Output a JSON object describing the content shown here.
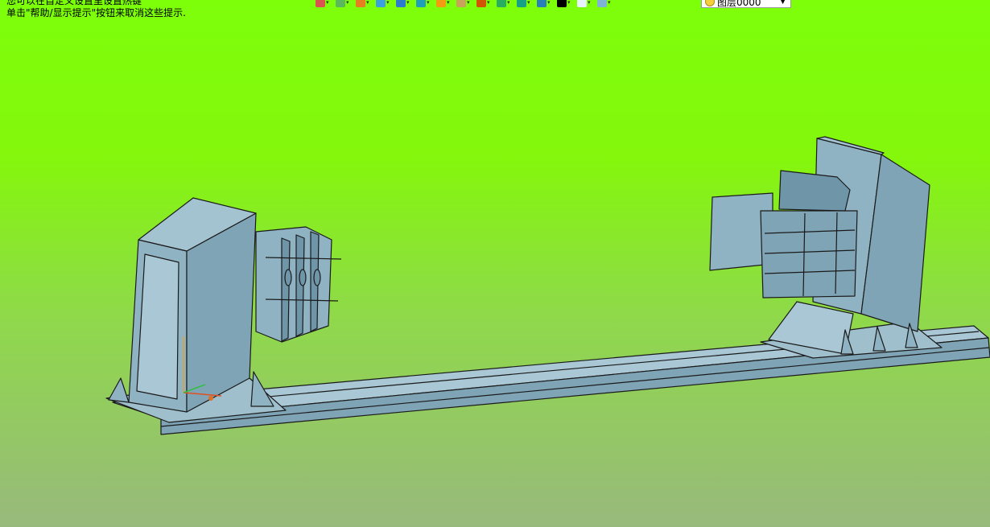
{
  "hints": {
    "line1": "您可以在自定义设置里设置热键",
    "line2": "单击\"帮助/显示提示\"按钮来取消这些提示."
  },
  "toolbar": {
    "buttons": [
      {
        "icon": "file-icon",
        "color": "#d9534f"
      },
      {
        "icon": "layers-icon",
        "color": "#5cb85c"
      },
      {
        "icon": "pencil-icon",
        "color": "#e67e22"
      },
      {
        "icon": "cube-icon",
        "color": "#3aa0e0"
      },
      {
        "icon": "cube-blue-icon",
        "color": "#2b7bd1"
      },
      {
        "icon": "box-icon",
        "color": "#1f9fb8"
      },
      {
        "icon": "sphere-icon",
        "color": "#f39c12"
      },
      {
        "icon": "clipboard-icon",
        "color": "#c8a45a"
      },
      {
        "icon": "crosshair-icon",
        "color": "#d35400"
      },
      {
        "icon": "page-icon",
        "color": "#27ae60"
      },
      {
        "icon": "frame-icon",
        "color": "#16a085"
      },
      {
        "icon": "monitor-icon",
        "color": "#2980b9"
      },
      {
        "icon": "color-swatch-icon",
        "color": "#000000"
      },
      {
        "icon": "blank-page-icon",
        "color": "#e8f4fb"
      },
      {
        "icon": "render-icon",
        "color": "#7fb3d5"
      }
    ],
    "layer_label": "图层0000"
  },
  "colors": {
    "part_fill": "#8fb3c3",
    "part_dark": "#6f96a8",
    "part_light": "#a9c7d4",
    "edge": "#1a1a1a"
  }
}
